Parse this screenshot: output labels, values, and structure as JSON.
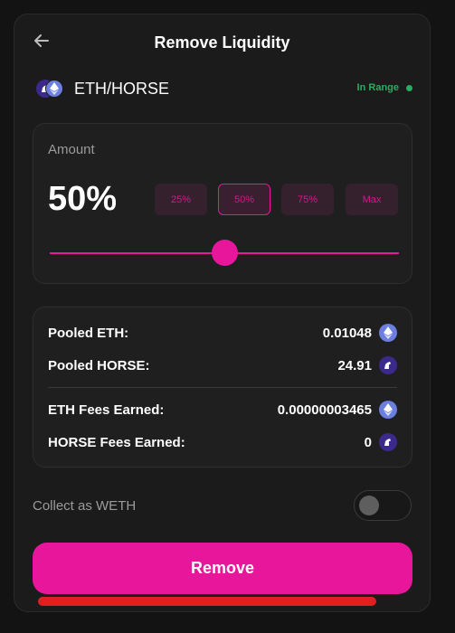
{
  "header": {
    "title": "Remove Liquidity"
  },
  "pair": {
    "label": "ETH/HORSE",
    "tokens": [
      "horse-token-icon",
      "eth-token-icon"
    ]
  },
  "range_status": {
    "label": "In Range",
    "color": "#27ae60"
  },
  "amount": {
    "label": "Amount",
    "value": "50%",
    "slider_percent": 50,
    "presets": [
      {
        "label": "25%",
        "active": false
      },
      {
        "label": "50%",
        "active": true
      },
      {
        "label": "75%",
        "active": false
      },
      {
        "label": "Max",
        "active": false
      }
    ]
  },
  "details": {
    "pooled_eth": {
      "label": "Pooled ETH:",
      "value": "0.01048"
    },
    "pooled_horse": {
      "label": "Pooled HORSE:",
      "value": "24.91"
    },
    "eth_fees": {
      "label": "ETH Fees Earned:",
      "value": "0.00000003465"
    },
    "horse_fees": {
      "label": "HORSE Fees Earned:",
      "value": "0"
    }
  },
  "collect_weth": {
    "label": "Collect as WETH",
    "enabled": false
  },
  "action": {
    "remove_label": "Remove"
  },
  "colors": {
    "accent": "#e8169b",
    "background": "#131313",
    "panel": "#1b1b1b",
    "annotation": "#e02020"
  }
}
